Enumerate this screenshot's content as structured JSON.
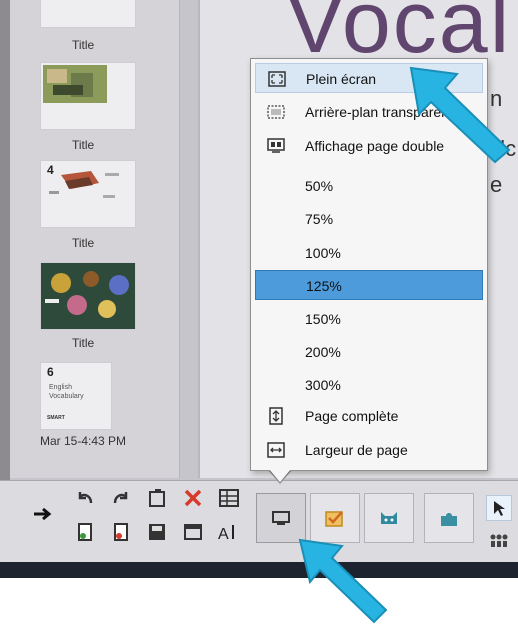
{
  "sorter": {
    "thumbs": [
      {
        "title": "Title"
      },
      {
        "title": "Title"
      },
      {
        "num": "4",
        "title": "Title"
      },
      {
        "title": "Title"
      },
      {
        "num": "6",
        "line1": "English",
        "line2": "Vocabulary",
        "logo": "SMART"
      }
    ],
    "timestamp": "Mar 15-4:43 PM"
  },
  "canvas": {
    "heading": "Vocal",
    "frag1": "n",
    "frag2": "alc",
    "frag3": "e"
  },
  "menu": {
    "items": [
      {
        "label": "Plein écran",
        "icon": "fullscreen-icon",
        "state": "hover"
      },
      {
        "label": "Arrière-plan transparent",
        "icon": "transparent-bg-icon"
      },
      {
        "label": "Affichage page double",
        "icon": "dual-page-icon"
      },
      {
        "label": "50%"
      },
      {
        "label": "75%"
      },
      {
        "label": "100%"
      },
      {
        "label": "125%",
        "state": "selected"
      },
      {
        "label": "150%"
      },
      {
        "label": "200%"
      },
      {
        "label": "300%"
      },
      {
        "label": "Page complète",
        "icon": "full-page-icon"
      },
      {
        "label": "Largeur de page",
        "icon": "page-width-icon"
      }
    ]
  },
  "colors": {
    "highlight": "#4d9bdb",
    "arrow": "#28b4e3",
    "vocab": "#60456f"
  }
}
